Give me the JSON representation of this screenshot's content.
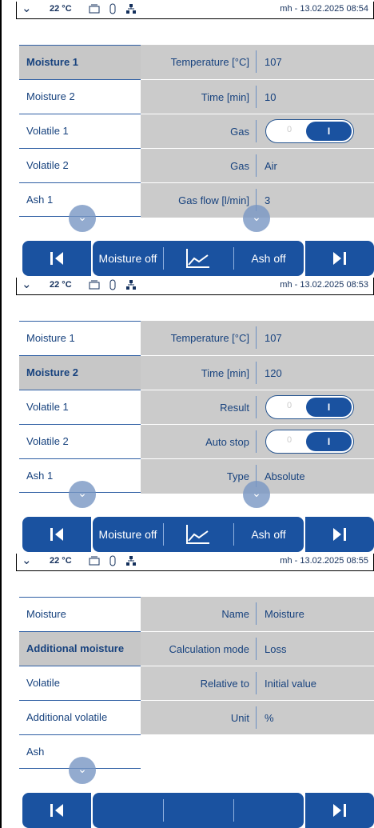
{
  "panels": [
    {
      "status": {
        "temperature": "22 °C",
        "datetime": "mh - 13.02.2025 08:54"
      },
      "left_items": [
        "Moisture 1",
        "Moisture 2",
        "Volatile 1",
        "Volatile 2",
        "Ash 1"
      ],
      "rows": [
        {
          "label": "Temperature [°C]",
          "value": "107"
        },
        {
          "label": "Time [min]",
          "value": "10"
        },
        {
          "label": "Gas",
          "toggle_off": "0",
          "toggle_on": "I"
        },
        {
          "label": "Gas",
          "value": "Air"
        },
        {
          "label": "Gas flow [l/min]",
          "value": "3"
        }
      ],
      "bottom": {
        "left_label": "Moisture off",
        "right_label": "Ash off"
      }
    },
    {
      "status": {
        "temperature": "22 °C",
        "datetime": "mh - 13.02.2025 08:53"
      },
      "left_items": [
        "Moisture 1",
        "Moisture 2",
        "Volatile 1",
        "Volatile 2",
        "Ash 1"
      ],
      "rows": [
        {
          "label": "Temperature [°C]",
          "value": "107"
        },
        {
          "label": "Time [min]",
          "value": "120"
        },
        {
          "label": "Result",
          "toggle_off": "0",
          "toggle_on": "I"
        },
        {
          "label": "Auto stop",
          "toggle_off": "0",
          "toggle_on": "I"
        },
        {
          "label": "Type",
          "value": "Absolute"
        }
      ],
      "bottom": {
        "left_label": "Moisture off",
        "right_label": "Ash off"
      }
    },
    {
      "status": {
        "temperature": "22 °C",
        "datetime": "mh - 13.02.2025 08:55"
      },
      "left_items": [
        "Moisture",
        "Additional moisture",
        "Volatile",
        "Additional volatile",
        "Ash"
      ],
      "rows": [
        {
          "label": "Name",
          "value": "Moisture"
        },
        {
          "label": "Calculation mode",
          "value": "Loss"
        },
        {
          "label": "Relative to",
          "value": "Initial value"
        },
        {
          "label": "Unit",
          "value": "%"
        }
      ],
      "bottom": {
        "left_label": "",
        "right_label": ""
      }
    }
  ],
  "icons": {
    "dropdown": "chevron-down-icon",
    "scroll": "chevron-down-icon",
    "balance": "balance-icon",
    "sensor": "sensor-icon",
    "network": "network-icon",
    "chart": "chart-icon",
    "first": "skip-back-icon",
    "last": "skip-forward-icon"
  },
  "colors": {
    "accent": "#1a52a0",
    "selected_bg": "#c7c7c7",
    "table_bg": "#cbcbcb",
    "text": "#17427e"
  }
}
